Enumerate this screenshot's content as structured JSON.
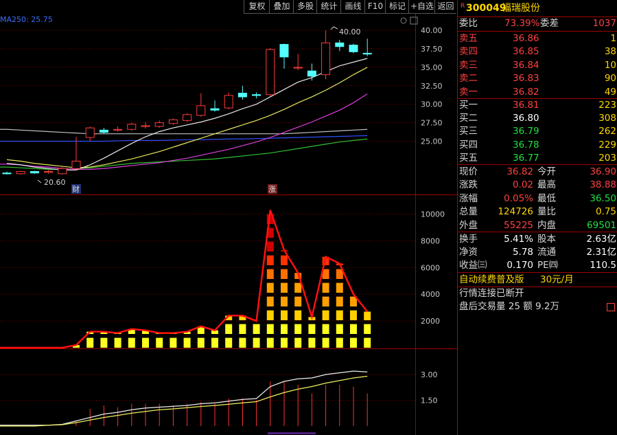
{
  "toolbar": {
    "buttons": [
      "复权",
      "叠加",
      "多股",
      "统计",
      "画线",
      "F10",
      "标记",
      "+自选",
      "返回"
    ]
  },
  "chart": {
    "ma_label": "MA250: 25.75",
    "price_ticks": [
      "40.00",
      "37.50",
      "35.00",
      "32.50",
      "30.00",
      "27.50",
      "25.00"
    ],
    "high_label": "40.00",
    "low_label": "20.60",
    "marker_cai": "财",
    "marker_zhang": "涨",
    "volume_ticks": [
      "10000",
      "8000",
      "6000",
      "4000",
      "2000"
    ],
    "indicator_ticks": [
      "3.00",
      "1.50"
    ]
  },
  "chart_data": [
    {
      "type": "candlestick",
      "yrange": [
        19,
        41.5
      ],
      "candles": [
        {
          "o": 20.7,
          "c": 20.6,
          "h": 20.9,
          "l": 20.5
        },
        {
          "o": 20.6,
          "c": 20.9,
          "h": 21.0,
          "l": 20.5
        },
        {
          "o": 20.9,
          "c": 20.7,
          "h": 21.0,
          "l": 20.6
        },
        {
          "o": 20.8,
          "c": 20.9,
          "h": 21.1,
          "l": 20.6
        },
        {
          "o": 20.6,
          "c": 21.3,
          "h": 21.5,
          "l": 20.5
        },
        {
          "o": 21.3,
          "c": 22.3,
          "h": 25.6,
          "l": 21.2
        },
        {
          "o": 25.5,
          "c": 26.8,
          "h": 27.0,
          "l": 25.0
        },
        {
          "o": 26.5,
          "c": 26.2,
          "h": 26.8,
          "l": 26.0
        },
        {
          "o": 26.5,
          "c": 26.6,
          "h": 27.0,
          "l": 26.3
        },
        {
          "o": 26.6,
          "c": 27.3,
          "h": 27.5,
          "l": 26.4
        },
        {
          "o": 27.1,
          "c": 27.1,
          "h": 27.6,
          "l": 26.7
        },
        {
          "o": 27.0,
          "c": 27.5,
          "h": 27.8,
          "l": 26.8
        },
        {
          "o": 27.4,
          "c": 27.9,
          "h": 28.1,
          "l": 27.2
        },
        {
          "o": 27.8,
          "c": 28.6,
          "h": 28.8,
          "l": 27.6
        },
        {
          "o": 28.5,
          "c": 29.8,
          "h": 31.5,
          "l": 28.3
        },
        {
          "o": 29.4,
          "c": 29.2,
          "h": 30.5,
          "l": 29.0
        },
        {
          "o": 29.5,
          "c": 31.2,
          "h": 31.6,
          "l": 29.3
        },
        {
          "o": 31.5,
          "c": 31.0,
          "h": 32.5,
          "l": 30.6
        },
        {
          "o": 31.3,
          "c": 31.2,
          "h": 31.6,
          "l": 30.8
        },
        {
          "o": 31.3,
          "c": 37.4,
          "h": 37.6,
          "l": 31.1
        },
        {
          "o": 38.1,
          "c": 36.4,
          "h": 38.2,
          "l": 34.8
        },
        {
          "o": 35.0,
          "c": 35.0,
          "h": 36.8,
          "l": 34.6
        },
        {
          "o": 34.5,
          "c": 33.8,
          "h": 35.5,
          "l": 33.2
        },
        {
          "o": 34.0,
          "c": 38.3,
          "h": 40.0,
          "l": 33.4
        },
        {
          "o": 38.3,
          "c": 37.8,
          "h": 38.7,
          "l": 37.2
        },
        {
          "o": 38.0,
          "c": 37.1,
          "h": 38.2,
          "l": 36.9
        },
        {
          "o": 36.9,
          "c": 36.82,
          "h": 38.88,
          "l": 36.5
        }
      ],
      "ma_white": [
        22.0,
        21.8,
        21.5,
        21.3,
        21.1,
        21.1,
        21.8,
        22.7,
        23.7,
        24.7,
        25.6,
        26.3,
        26.8,
        27.2,
        27.6,
        28.1,
        28.7,
        29.4,
        30.0,
        31.0,
        32.0,
        33.0,
        33.6,
        34.4,
        35.2,
        35.7,
        36.2
      ],
      "ma_yellow": [
        22.5,
        22.3,
        22.0,
        21.8,
        21.6,
        21.4,
        21.5,
        21.8,
        22.2,
        22.6,
        23.1,
        23.6,
        24.2,
        24.8,
        25.4,
        26.0,
        26.6,
        27.2,
        27.8,
        28.5,
        29.3,
        30.2,
        31.0,
        31.9,
        32.9,
        34.0,
        35.0
      ],
      "ma_magenta": [
        21.9,
        21.8,
        21.6,
        21.5,
        21.3,
        21.2,
        21.2,
        21.3,
        21.5,
        21.7,
        21.9,
        22.1,
        22.4,
        22.7,
        23.1,
        23.5,
        23.9,
        24.4,
        24.9,
        25.5,
        26.2,
        26.9,
        27.6,
        28.4,
        29.2,
        30.2,
        31.4
      ],
      "ma_green": [
        21.5,
        21.4,
        21.3,
        21.2,
        21.2,
        21.3,
        21.4,
        21.6,
        21.8,
        22.0,
        22.1,
        22.2,
        22.3,
        22.4,
        22.5,
        22.6,
        22.8,
        23.0,
        23.2,
        23.4,
        23.7,
        24.0,
        24.3,
        24.6,
        24.9,
        25.1,
        25.3
      ],
      "ma_gray": [
        26.6,
        26.5,
        26.4,
        26.3,
        26.2,
        26.1,
        26.0,
        26.0,
        26.0,
        26.0,
        26.0,
        26.0,
        26.0,
        26.0,
        26.0,
        26.0,
        26.0,
        26.0,
        26.0,
        26.0,
        26.0,
        26.1,
        26.2,
        26.3,
        26.4,
        26.5,
        26.6
      ],
      "ma_blue": [
        25.0,
        25.0,
        25.0,
        25.0,
        25.0,
        25.0,
        25.0,
        25.0,
        25.05,
        25.1,
        25.1,
        25.1,
        25.15,
        25.2,
        25.2,
        25.25,
        25.3,
        25.3,
        25.35,
        25.4,
        25.45,
        25.5,
        25.55,
        25.6,
        25.65,
        25.7,
        25.75
      ]
    },
    {
      "type": "bar",
      "yrange": [
        0,
        11000
      ],
      "values": [
        0,
        0,
        0,
        0,
        0,
        200,
        1200,
        1200,
        1100,
        1400,
        1300,
        1100,
        1100,
        1200,
        1600,
        1300,
        2400,
        2400,
        2000,
        10300,
        7300,
        5600,
        2300,
        6800,
        6300,
        4000,
        2700
      ]
    },
    {
      "type": "line",
      "yrange": [
        0,
        4
      ],
      "white": [
        0.05,
        0.05,
        0.05,
        0.05,
        0.1,
        0.3,
        0.5,
        0.7,
        0.8,
        0.95,
        1.05,
        1.1,
        1.15,
        1.2,
        1.3,
        1.35,
        1.45,
        1.55,
        1.6,
        2.3,
        2.6,
        2.75,
        2.8,
        3.0,
        3.1,
        3.2,
        3.15
      ],
      "yellow": [
        0.0,
        0.0,
        0.0,
        0.05,
        0.08,
        0.2,
        0.35,
        0.5,
        0.62,
        0.75,
        0.85,
        0.95,
        1.0,
        1.07,
        1.14,
        1.2,
        1.27,
        1.35,
        1.42,
        1.7,
        1.95,
        2.15,
        2.3,
        2.5,
        2.65,
        2.8,
        2.9
      ],
      "bars": [
        0,
        0,
        0,
        0,
        0,
        0.3,
        1.0,
        1.2,
        1.1,
        1.3,
        1.3,
        1.3,
        1.2,
        1.3,
        1.4,
        1.3,
        1.6,
        1.6,
        1.5,
        2.6,
        2.6,
        2.4,
        1.9,
        2.4,
        2.4,
        2.3,
        1.9
      ]
    }
  ],
  "panel": {
    "code": "300049",
    "name": "福瑞股份",
    "r_badge": "R",
    "weibi_label": "委比",
    "weibi_val": "73.39%",
    "weicha_label": "委差",
    "weicha_val": "1037",
    "sells": [
      {
        "label": "卖五",
        "price": "36.86",
        "vol": "1"
      },
      {
        "label": "卖四",
        "price": "36.85",
        "vol": "38"
      },
      {
        "label": "卖三",
        "price": "36.84",
        "vol": "10"
      },
      {
        "label": "卖二",
        "price": "36.83",
        "vol": "90"
      },
      {
        "label": "卖一",
        "price": "36.82",
        "vol": "49"
      }
    ],
    "buys": [
      {
        "label": "买一",
        "price": "36.81",
        "vol": "223"
      },
      {
        "label": "买二",
        "price": "36.80",
        "vol": "308"
      },
      {
        "label": "买三",
        "price": "36.79",
        "vol": "262"
      },
      {
        "label": "买四",
        "price": "36.78",
        "vol": "229"
      },
      {
        "label": "买五",
        "price": "36.77",
        "vol": "203"
      }
    ],
    "stats": [
      {
        "l1": "现价",
        "v1": "36.82",
        "l2": "今开",
        "v2": "36.90"
      },
      {
        "l1": "涨跌",
        "v1": "0.02",
        "l2": "最高",
        "v2": "38.88"
      },
      {
        "l1": "涨幅",
        "v1": "0.05%",
        "l2": "最低",
        "v2": "36.50"
      },
      {
        "l1": "总量",
        "v1": "124726",
        "l2": "量比",
        "v2": "0.75"
      },
      {
        "l1": "外盘",
        "v1": "55225",
        "l2": "内盘",
        "v2": "69501"
      }
    ],
    "stats2": [
      {
        "l1": "换手",
        "v1": "5.41%",
        "l2": "股本",
        "v2": "2.63亿"
      },
      {
        "l1": "净资",
        "v1": "5.78",
        "l2": "流通",
        "v2": "2.31亿"
      },
      {
        "l1": "收益㈢",
        "v1": "0.170",
        "l2": "PE㈣",
        "v2": "110.5"
      }
    ],
    "promo_text": "自动续费普及版",
    "promo_price": "30元/月",
    "status_text": "行情连接已断开",
    "after_hours": "盘后交易量 25 额 9.2万"
  },
  "colors": {
    "up": "#ff3c3c",
    "down": "#54ffff",
    "ma_white": "#e8e8e8",
    "ma_yellow": "#e8e85a",
    "ma_magenta": "#e040e0",
    "ma_green": "#30c030",
    "ma_blue": "#3050ff",
    "ma_gray": "#c0c0c0"
  }
}
